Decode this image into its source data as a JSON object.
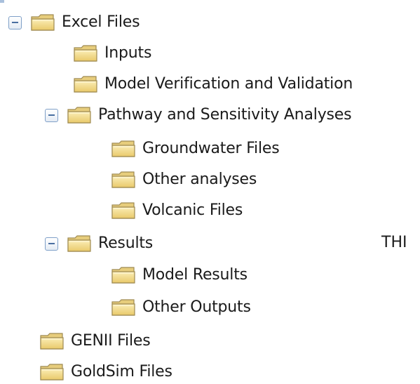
{
  "tree": {
    "excel_files": "Excel Files",
    "inputs": "Inputs",
    "model_verification": "Model Verification and Validation",
    "pathway": "Pathway and Sensitivity Analyses",
    "groundwater": "Groundwater Files",
    "other_analyses": "Other analyses",
    "volcanic": "Volcanic Files",
    "results": "Results",
    "model_results": "Model Results",
    "other_outputs": "Other Outputs",
    "genii": "GENII Files",
    "goldsim": "GoldSim Files"
  },
  "stray_text": "THI",
  "icons": {
    "folder": "folder-icon",
    "collapse": "minus-box-icon"
  },
  "colors": {
    "folder_fill": "#f3dc8e",
    "folder_outline": "#9e8a52",
    "toggle_border": "#7fa0c8"
  }
}
